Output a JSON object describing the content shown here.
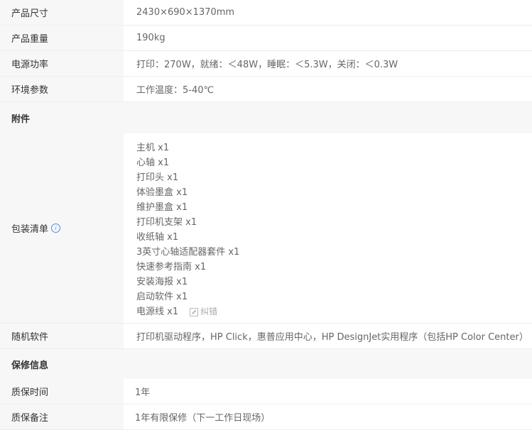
{
  "rows_top": [
    {
      "label": "产品尺寸",
      "value": "2430×690×1370mm"
    },
    {
      "label": "产品重量",
      "value": "190kg"
    },
    {
      "label": "电源功率",
      "value": "打印：270W，就绪：＜48W，睡眠：＜5.3W，关闭：＜0.3W"
    },
    {
      "label": "环境参数",
      "value": "工作温度：5-40℃"
    }
  ],
  "section_accessories": "附件",
  "package": {
    "label": "包装清单",
    "items": [
      "主机 x1",
      "心轴 x1",
      "打印头 x1",
      "体验墨盒 x1",
      "维护墨盒 x1",
      "打印机支架 x1",
      "收纸轴 x1",
      "3英寸心轴适配器套件 x1",
      "快速参考指南 x1",
      "安装海报 x1",
      "启动软件 x1",
      "电源线 x1"
    ],
    "correction_label": "纠错",
    "info_icon": "info-icon",
    "pencil_icon": "pencil-icon"
  },
  "software": {
    "label": "随机软件",
    "value": "打印机驱动程序，HP Click，惠普应用中心，HP DesignJet实用程序（包括HP Color Center）"
  },
  "section_warranty": "保修信息",
  "warranty_rows": [
    {
      "label": "质保时间",
      "value": "1年"
    },
    {
      "label": "质保备注",
      "value": "1年有限保修（下一工作日现场）"
    }
  ],
  "colors": {
    "label_bg": "#f7f7f7",
    "info_blue": "#4a90e2",
    "value_text": "#666666"
  }
}
